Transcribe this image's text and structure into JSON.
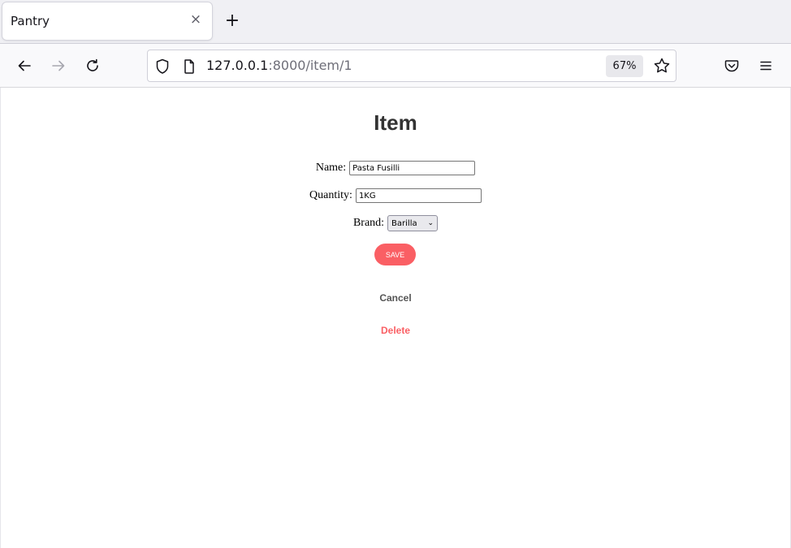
{
  "browser": {
    "tab_title": "Pantry",
    "tab_close_glyph": "×",
    "new_tab_glyph": "+",
    "url_host": "127.0.0.1",
    "url_rest": ":8000/item/1",
    "zoom_level": "67%"
  },
  "page": {
    "heading": "Item",
    "form": {
      "name_label": "Name:",
      "name_value": "Pasta Fusilli",
      "quantity_label": "Quantity:",
      "quantity_value": "1KG",
      "brand_label": "Brand:",
      "brand_selected": "Barilla"
    },
    "save_label": "SAVE",
    "cancel_label": "Cancel",
    "delete_label": "Delete"
  },
  "colors": {
    "accent_red": "#fa5f64",
    "heading_text": "#333333",
    "cancel_text": "#555555"
  },
  "icons": {
    "back": "back-arrow-icon",
    "forward": "forward-arrow-icon",
    "reload": "reload-icon",
    "shield": "shield-icon",
    "page": "page-icon",
    "star": "star-icon",
    "pocket": "pocket-icon",
    "menu": "hamburger-menu-icon"
  }
}
